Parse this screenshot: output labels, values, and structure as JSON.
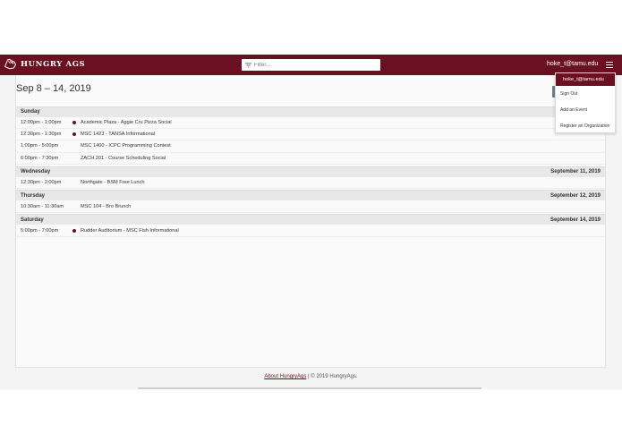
{
  "navbar": {
    "app_title": "Hungry Ags",
    "filter_placeholder": "Filter...",
    "user_email": "hoke_t@tamu.edu"
  },
  "calendar": {
    "range_title": "Sep 8 – 14, 2019",
    "days": [
      {
        "label": "Sunday",
        "date": "",
        "events": [
          {
            "time": "12:00pm - 1:00pm",
            "title": "Academic Plaza - Aggie Cru Pizza Social",
            "dot": true
          },
          {
            "time": "12:30pm - 1:30pm",
            "title": "MSC 1423 - TANSA Informational",
            "dot": true
          },
          {
            "time": "1:00pm - 5:00pm",
            "title": "MSC 1400 - ICPC Programming Contest",
            "dot": false
          },
          {
            "time": "6:00pm - 7:30pm",
            "title": "ZACH 201 - Course Scheduling Social",
            "dot": false
          }
        ]
      },
      {
        "label": "Wednesday",
        "date": "September 11, 2019",
        "events": [
          {
            "time": "12:30pm - 2:00pm",
            "title": "Northgate - BSM Free Lunch",
            "dot": false
          }
        ]
      },
      {
        "label": "Thursday",
        "date": "September 12, 2019",
        "events": [
          {
            "time": "10:30am - 11:30am",
            "title": "MSC 104 - Bro Brunch",
            "dot": false
          }
        ]
      },
      {
        "label": "Saturday",
        "date": "September 14, 2019",
        "events": [
          {
            "time": "5:00pm - 7:00pm",
            "title": "Rudder Auditorium - MSC Fish Informational",
            "dot": true
          }
        ]
      }
    ]
  },
  "dropdown": {
    "header_email": "hoke_t@tamu.edu",
    "items": [
      "Sign Out",
      "Add an Event",
      "Register an Organization"
    ]
  },
  "footer": {
    "link_text": "About HungryAgs",
    "copyright": " | © 2019 HungryAgs."
  },
  "colors": {
    "brand": "#6b1020",
    "event_dot": "#6b1020"
  }
}
